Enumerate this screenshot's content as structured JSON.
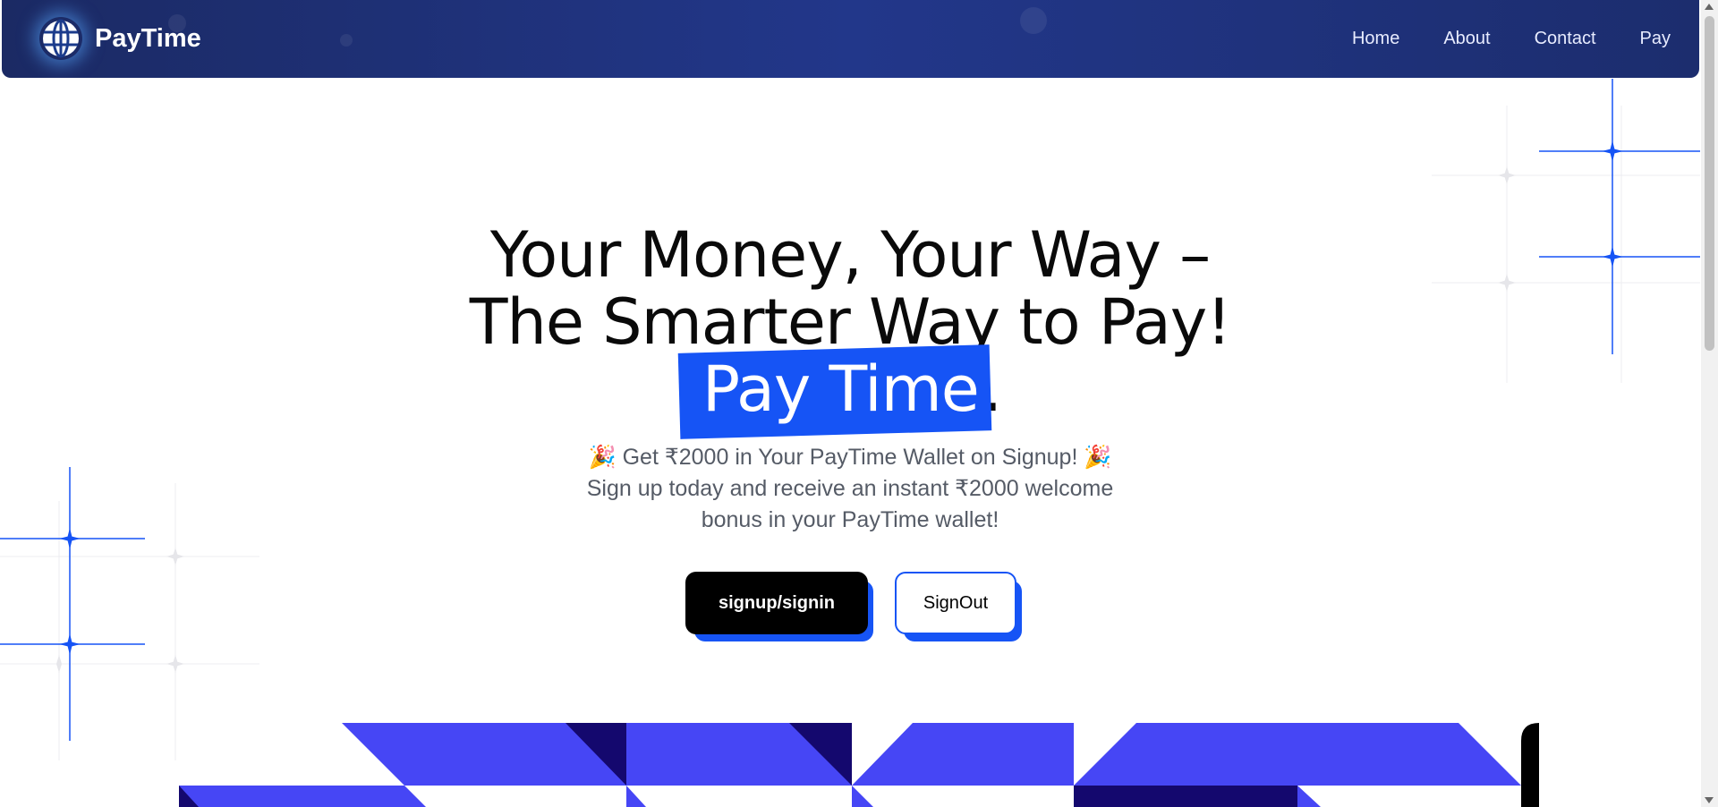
{
  "navbar": {
    "brand": "PayTime",
    "links": [
      "Home",
      "About",
      "Contact",
      "Pay"
    ]
  },
  "hero": {
    "title_line1": "Your Money, Your Way –",
    "title_line2": "The Smarter Way to Pay!",
    "highlight": "Pay Time",
    "title_end": ".",
    "subtitle": "🎉 Get ₹2000 in Your PayTime Wallet on Signup! 🎉 Sign up today and receive an instant ₹2000 welcome bonus in your PayTime wallet!"
  },
  "buttons": {
    "primary": "signup/signin",
    "secondary": "SignOut"
  },
  "colors": {
    "nav_bg": "#1e3278",
    "accent_blue": "#1654f5",
    "banner_blue": "#4646f5",
    "banner_navy": "#14086e"
  },
  "icons": {
    "logo": "globe-icon"
  }
}
